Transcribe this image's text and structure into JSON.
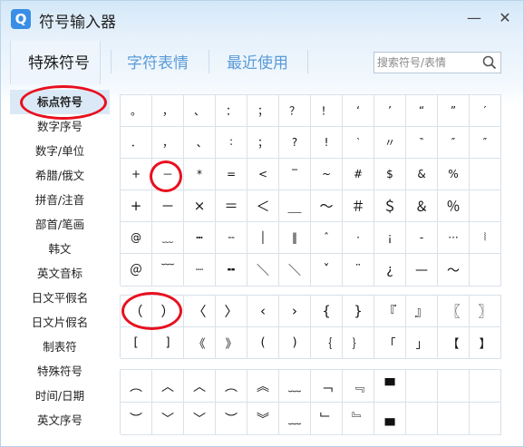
{
  "window": {
    "title": "符号输入器",
    "logo_letter": "Q",
    "minimize": "—",
    "close": "✕"
  },
  "tabs": [
    {
      "label": "特殊符号",
      "active": true
    },
    {
      "label": "字符表情",
      "active": false
    },
    {
      "label": "最近使用",
      "active": false
    }
  ],
  "search": {
    "placeholder": "搜索符号/表情",
    "value": ""
  },
  "sidebar": [
    {
      "label": "标点符号",
      "active": true
    },
    {
      "label": "数字序号",
      "active": false
    },
    {
      "label": "数字/单位",
      "active": false
    },
    {
      "label": "希腊/俄文",
      "active": false
    },
    {
      "label": "拼音/注音",
      "active": false
    },
    {
      "label": "部首/笔画",
      "active": false
    },
    {
      "label": "韩文",
      "active": false
    },
    {
      "label": "英文音标",
      "active": false
    },
    {
      "label": "日文平假名",
      "active": false
    },
    {
      "label": "日文片假名",
      "active": false
    },
    {
      "label": "制表符",
      "active": false
    },
    {
      "label": "特殊符号",
      "active": false
    },
    {
      "label": "时间/日期",
      "active": false
    },
    {
      "label": "英文序号",
      "active": false
    }
  ],
  "grid1": [
    [
      "。",
      "，",
      "、",
      "：",
      "；",
      "？",
      "！",
      "‘",
      "’",
      "“",
      "”",
      "′"
    ],
    [
      "．",
      "，",
      "､",
      "∶",
      "；",
      "?",
      "!",
      "‵",
      "〃",
      "‶",
      "″",
      "″"
    ],
    [
      "+",
      "－",
      "*",
      "=",
      "<",
      "‾",
      "~",
      "#",
      "$",
      "&",
      "%",
      ""
    ],
    [
      "+",
      "－",
      "×",
      "＝",
      "＜",
      "＿",
      "～",
      "＃",
      "＄",
      "＆",
      "％",
      ""
    ],
    [
      "@",
      "﹏",
      "┅",
      "╌",
      "│",
      "‖",
      "ˆ",
      "·",
      "¡",
      "-",
      "···",
      "⦚"
    ],
    [
      "＠",
      "﹋",
      "┈",
      "╍",
      "＼",
      "＼",
      "ˇ",
      "¨",
      "¿",
      "—",
      "～",
      ""
    ]
  ],
  "grid2": [
    [
      "（",
      "）",
      "〈",
      "〉",
      "‹",
      "›",
      "{",
      "}",
      "『",
      "』",
      "〖",
      "〗"
    ],
    [
      "[",
      "]",
      "《",
      "》",
      "(",
      ")",
      "｛",
      "｝",
      "「",
      "」",
      "【",
      "】"
    ]
  ],
  "grid3": [
    [
      "︵",
      "︿",
      "︿",
      "︵",
      "︽",
      "﹏",
      "﹁",
      "﹃",
      "▀",
      "",
      "",
      ""
    ],
    [
      "︶",
      "﹀",
      "﹀",
      "︶",
      "︾",
      "﹏",
      "﹂",
      "﹄",
      "▄",
      "",
      "",
      ""
    ]
  ],
  "colors": {
    "accent": "#3a8ee6",
    "annotation": "#e8101e",
    "tab_inactive": "#5a9bd8"
  }
}
